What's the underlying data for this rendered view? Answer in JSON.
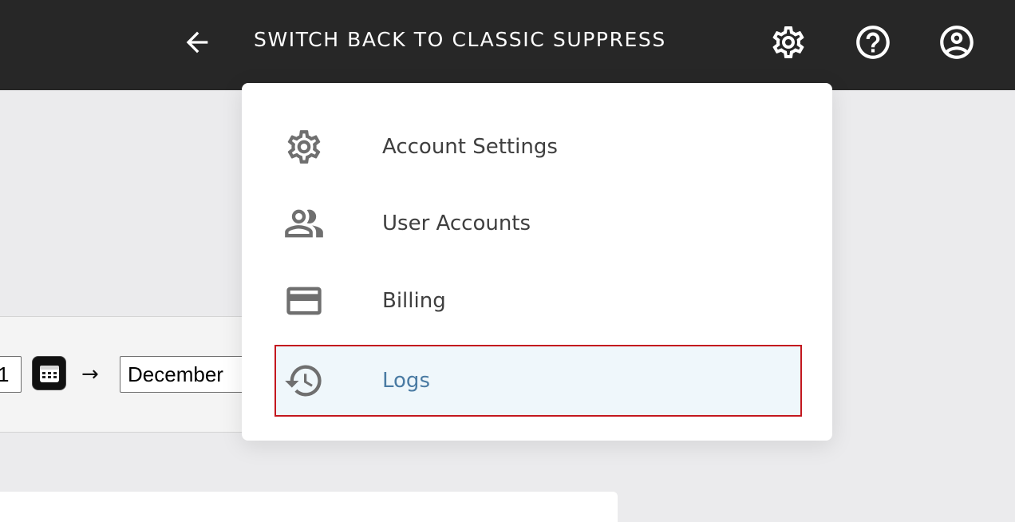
{
  "topbar": {
    "back_icon": "arrow-left-icon",
    "classic_link_label": "SWITCH BACK TO CLASSIC SUPPRESS",
    "icons": [
      "gear-icon",
      "help-circle-icon",
      "account-circle-icon"
    ]
  },
  "filters": {
    "date_from_value": "1",
    "calendar_icon": "calendar-icon",
    "separator": "→",
    "date_to_value": "December"
  },
  "menu": {
    "items": [
      {
        "label": "Account Settings",
        "icon": "gear-icon"
      },
      {
        "label": "User Accounts",
        "icon": "users-icon"
      },
      {
        "label": "Billing",
        "icon": "credit-card-icon"
      },
      {
        "label": "Logs",
        "icon": "history-icon"
      }
    ],
    "highlighted_index": 3
  },
  "colors": {
    "topbar_bg": "#272727",
    "page_bg": "#ebebed",
    "highlight_bg": "#eff7fb",
    "highlight_border": "#c3171e",
    "highlight_text": "#4a7ba3",
    "icon_gray": "#6f6f6f"
  }
}
